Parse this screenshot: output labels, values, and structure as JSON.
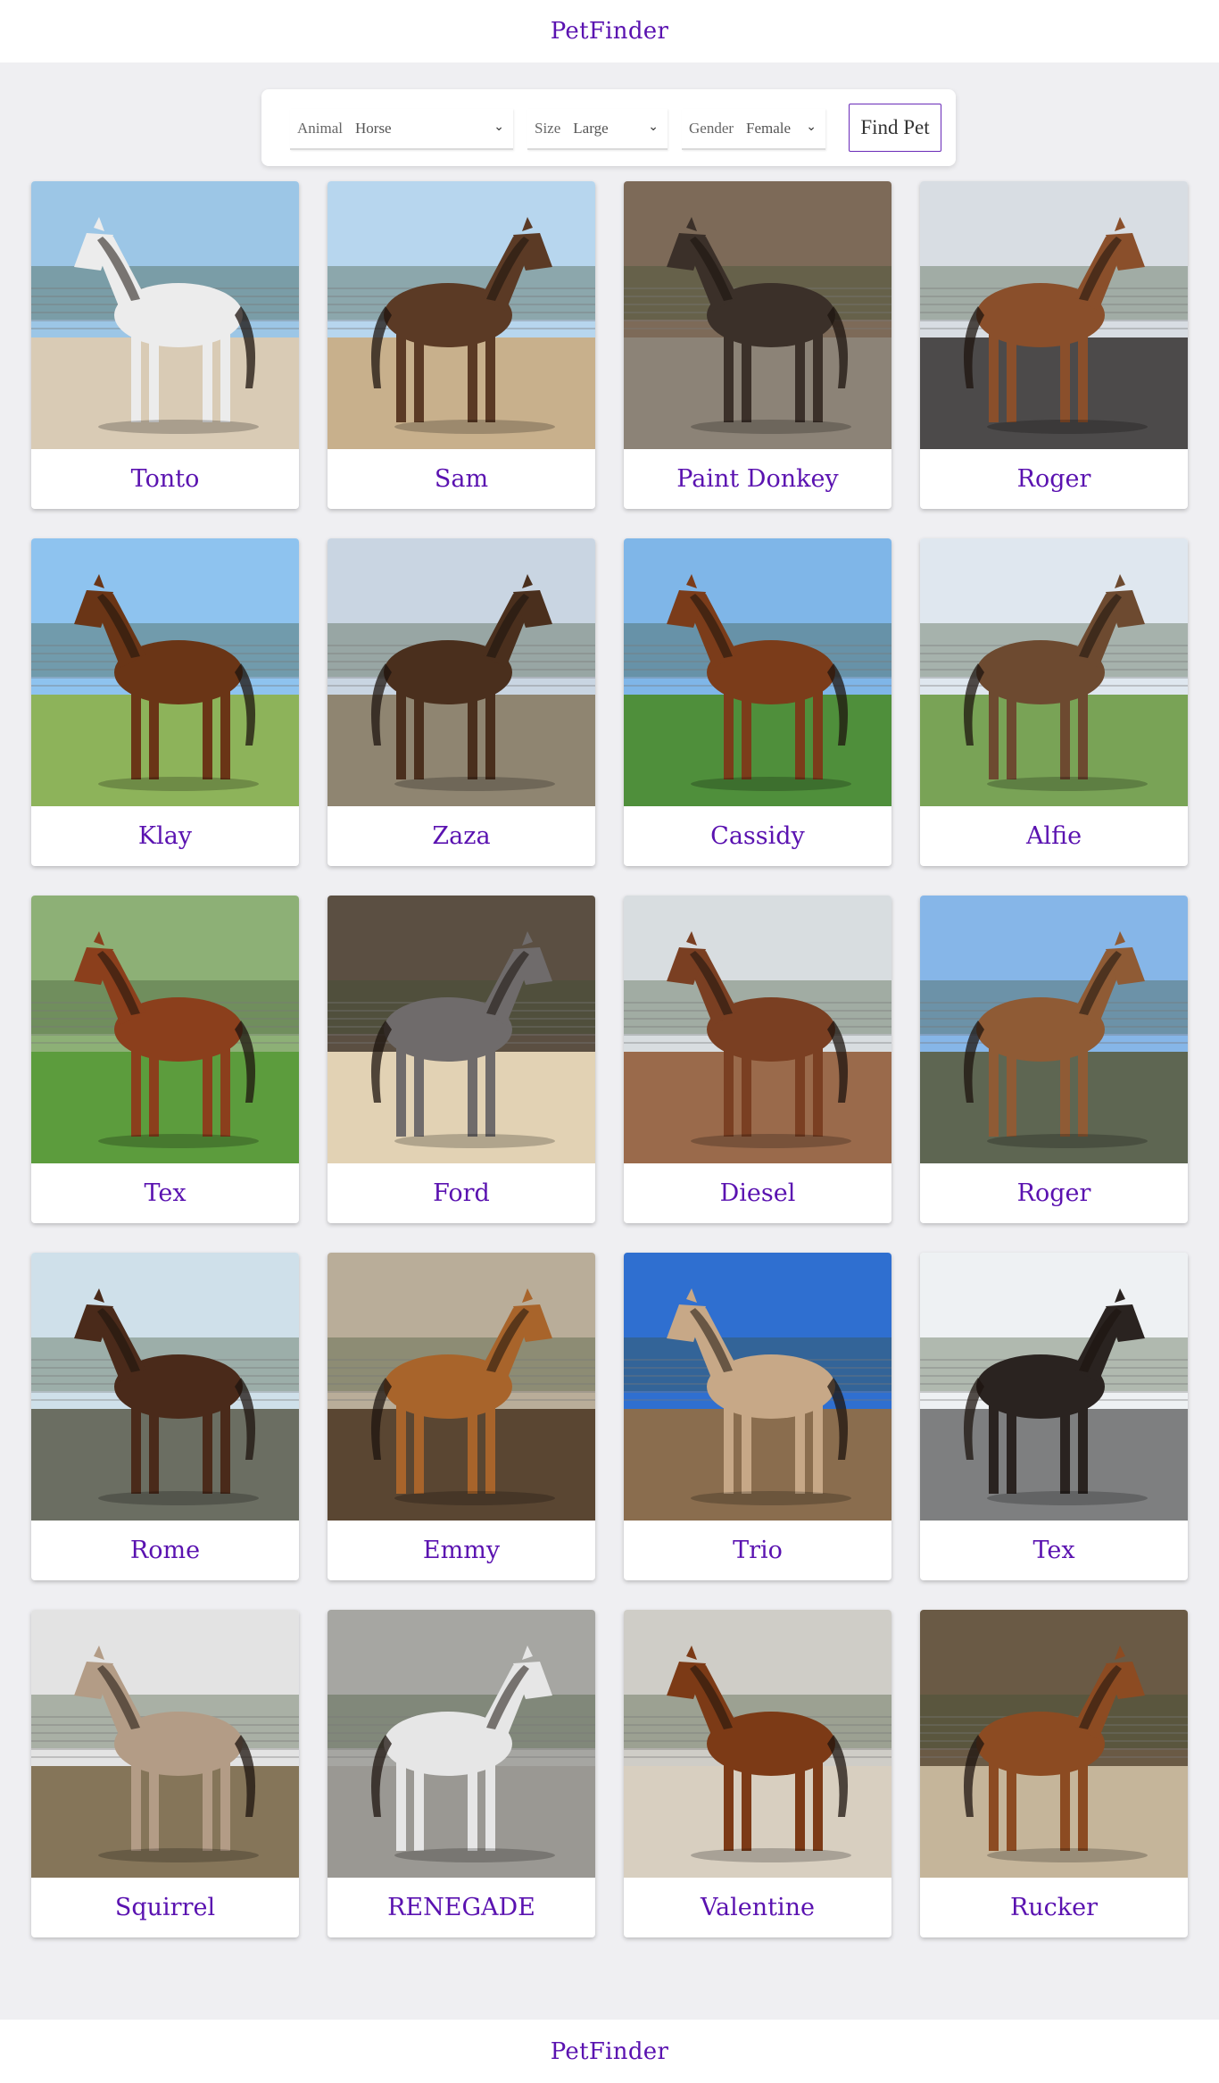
{
  "header": {
    "brand": "PetFinder"
  },
  "filters": {
    "animal": {
      "label": "Animal",
      "value": "Horse"
    },
    "size": {
      "label": "Size",
      "value": "Large"
    },
    "gender": {
      "label": "Gender",
      "value": "Female"
    },
    "submit_label": "Find Pet"
  },
  "pets": [
    {
      "name": "Tonto",
      "coat": "#ececec",
      "sky": "#9cc6e6",
      "ground": "#d9cbb5"
    },
    {
      "name": "Sam",
      "coat": "#5b3a25",
      "sky": "#b7d6ee",
      "ground": "#c8b08c"
    },
    {
      "name": "Paint Donkey",
      "coat": "#3b3029",
      "sky": "#7d6a58",
      "ground": "#8c8377"
    },
    {
      "name": "Roger",
      "coat": "#8a4f2b",
      "sky": "#d8dde3",
      "ground": "#4c4a4a"
    },
    {
      "name": "Klay",
      "coat": "#6a3516",
      "sky": "#8ec3ef",
      "ground": "#8db35a"
    },
    {
      "name": "Zaza",
      "coat": "#4a2f1d",
      "sky": "#c9d5e2",
      "ground": "#8f8571"
    },
    {
      "name": "Cassidy",
      "coat": "#7b3c1a",
      "sky": "#7fb6e8",
      "ground": "#4f8f3b"
    },
    {
      "name": "Alfie",
      "coat": "#6d4a30",
      "sky": "#dfe7ef",
      "ground": "#79a356"
    },
    {
      "name": "Tex",
      "coat": "#8b3f1c",
      "sky": "#8db076",
      "ground": "#5c9c3d"
    },
    {
      "name": "Ford",
      "coat": "#6f6b6b",
      "sky": "#5b4f42",
      "ground": "#e2d2b4"
    },
    {
      "name": "Diesel",
      "coat": "#7a3f22",
      "sky": "#d8dde0",
      "ground": "#9a6a4b"
    },
    {
      "name": "Roger",
      "coat": "#8f5b35",
      "sky": "#86b6e8",
      "ground": "#5e6652"
    },
    {
      "name": "Rome",
      "coat": "#4a2a1a",
      "sky": "#cfe0ea",
      "ground": "#6b6e62"
    },
    {
      "name": "Emmy",
      "coat": "#a8642b",
      "sky": "#b9ad99",
      "ground": "#5a4632"
    },
    {
      "name": "Trio",
      "coat": "#c7a887",
      "sky": "#2f6fd0",
      "ground": "#8a6d4e"
    },
    {
      "name": "Tex",
      "coat": "#2a2320",
      "sky": "#eef1f3",
      "ground": "#7e7f80"
    },
    {
      "name": "Squirrel",
      "coat": "#b39c86",
      "sky": "#e3e3e3",
      "ground": "#857559"
    },
    {
      "name": "RENEGADE",
      "coat": "#e6e6e6",
      "sky": "#a6a6a2",
      "ground": "#9a9893"
    },
    {
      "name": "Valentine",
      "coat": "#7c3a16",
      "sky": "#cfcdc7",
      "ground": "#d8cfc0"
    },
    {
      "name": "Rucker",
      "coat": "#8c4b22",
      "sky": "#6a5a45",
      "ground": "#c5b59a"
    }
  ],
  "footer": {
    "brand": "PetFinder"
  },
  "colors": {
    "accent": "#5a12b0",
    "page_bg": "#efeff2"
  }
}
